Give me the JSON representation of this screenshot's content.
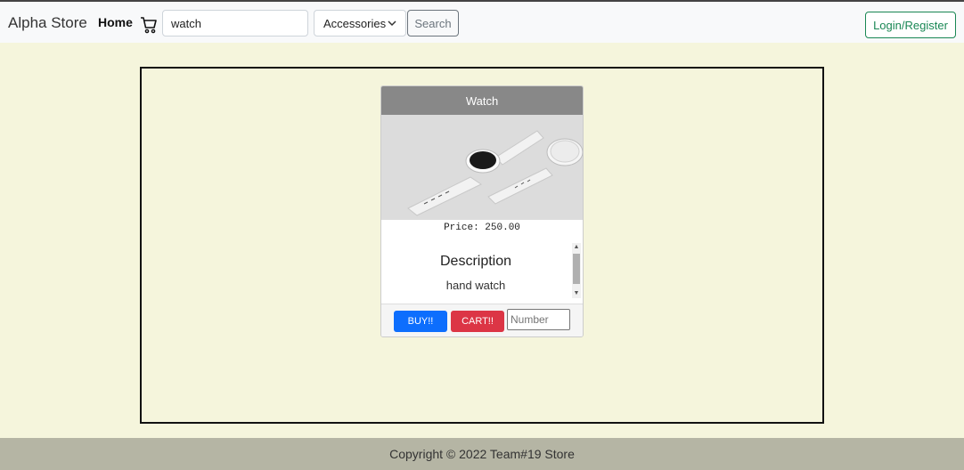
{
  "navbar": {
    "brand": "Alpha Store",
    "home_label": "Home",
    "search": {
      "value": "watch"
    },
    "category": {
      "selected": "Accessories"
    },
    "search_button": "Search",
    "login_button": "Login/Register"
  },
  "product": {
    "title": "Watch",
    "price_text": "Price: 250.00",
    "description_title": "Description",
    "description_text": "hand watch",
    "buy_button": "BUY!!",
    "cart_button": "CART!!",
    "quantity_placeholder": "Number"
  },
  "footer": {
    "copyright": "Copyright © 2022 Team#19 Store"
  },
  "colors": {
    "page_background": "#f5f5dc",
    "buy": "#0d6efd",
    "cart": "#dc3545",
    "login": "#198754"
  }
}
